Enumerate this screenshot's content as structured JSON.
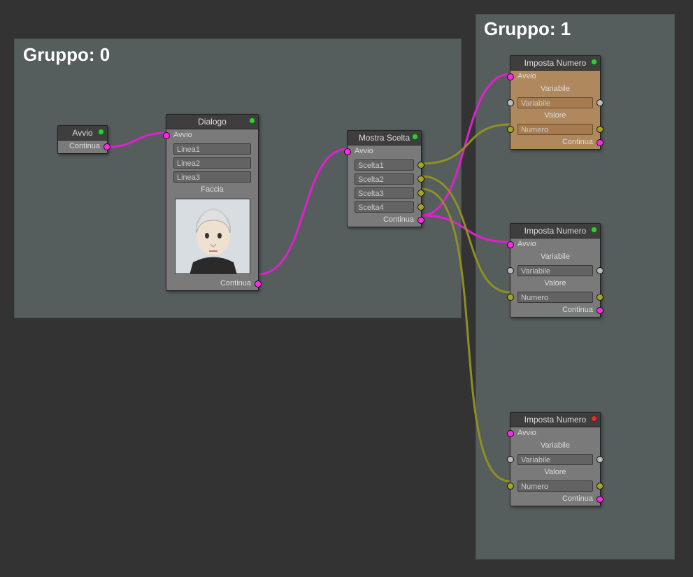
{
  "groups": {
    "g0": {
      "title": "Gruppo: 0"
    },
    "g1": {
      "title": "Gruppo: 1"
    }
  },
  "nodes": {
    "avvio": {
      "title": "Avvio",
      "continua": "Continua"
    },
    "dialogo": {
      "title": "Dialogo",
      "avvio": "Avvio",
      "linea1": "Linea1",
      "linea2": "Linea2",
      "linea3": "Linea3",
      "faccia": "Faccia",
      "continua": "Continua"
    },
    "mostra": {
      "title": "Mostra Scelta",
      "avvio": "Avvio",
      "scelta1": "Scelta1",
      "scelta2": "Scelta2",
      "scelta3": "Scelta3",
      "scelta4": "Scelta4",
      "continua": "Continua"
    },
    "imposta1": {
      "title": "Imposta Numero",
      "avvio": "Avvio",
      "variabile_lbl": "Variabile",
      "variabile_val": "Variabile",
      "valore_lbl": "Valore",
      "numero_val": "Numero",
      "continua": "Continua"
    },
    "imposta2": {
      "title": "Imposta Numero",
      "avvio": "Avvio",
      "variabile_lbl": "Variabile",
      "variabile_val": "Variabile",
      "valore_lbl": "Valore",
      "numero_val": "Numero",
      "continua": "Continua"
    },
    "imposta3": {
      "title": "Imposta Numero",
      "avvio": "Avvio",
      "variabile_lbl": "Variabile",
      "variabile_val": "Variabile",
      "valore_lbl": "Valore",
      "numero_val": "Numero",
      "continua": "Continua"
    }
  }
}
